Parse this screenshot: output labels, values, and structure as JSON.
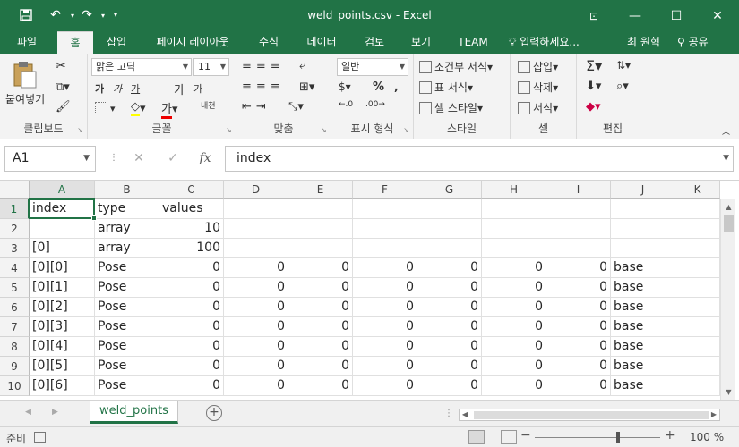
{
  "window": {
    "title": "weld_points.csv - Excel",
    "save_icon": "save-icon",
    "undo_icon": "undo-icon",
    "redo_icon": "redo-icon",
    "customize_icon": "customize-qat-icon"
  },
  "tabs": [
    "파일",
    "홈",
    "삽입",
    "페이지 레이아웃",
    "수식",
    "데이터",
    "검토",
    "보기",
    "TEAM"
  ],
  "active_tab": "홈",
  "tell_me": "입력하세요...",
  "user_name": "최 원혁",
  "share_label": "공유",
  "ribbon": {
    "clipboard": {
      "label": "클립보드",
      "paste": "붙여넣기"
    },
    "font": {
      "label": "글꼴",
      "font_name": "맑은 고딕",
      "font_size": "11",
      "bold": "가",
      "italic": "가",
      "underline": "가",
      "grow": "가",
      "shrink": "가",
      "color_text": "가",
      "phonetic": "내천"
    },
    "alignment": {
      "label": "맞춤"
    },
    "number": {
      "label": "표시 형식",
      "format": "일반"
    },
    "styles": {
      "label": "스타일",
      "conditional": "조건부 서식",
      "table": "표 서식",
      "cell": "셀 스타일"
    },
    "cells": {
      "label": "셀",
      "insert": "삽입",
      "delete": "삭제",
      "format": "서식"
    },
    "editing": {
      "label": "편집"
    }
  },
  "formula_bar": {
    "name_box": "A1",
    "cancel": "✕",
    "enter": "✓",
    "fx": "fx",
    "content": "index"
  },
  "grid": {
    "columns": [
      "A",
      "B",
      "C",
      "D",
      "E",
      "F",
      "G",
      "H",
      "I",
      "J",
      "K"
    ],
    "rows": [
      [
        "index",
        "type",
        "values",
        "",
        "",
        "",
        "",
        "",
        "",
        "",
        ""
      ],
      [
        "",
        "array",
        "10",
        "",
        "",
        "",
        "",
        "",
        "",
        "",
        ""
      ],
      [
        "[0]",
        "array",
        "100",
        "",
        "",
        "",
        "",
        "",
        "",
        "",
        ""
      ],
      [
        "[0][0]",
        "Pose",
        "0",
        "0",
        "0",
        "0",
        "0",
        "0",
        "0",
        "base",
        ""
      ],
      [
        "[0][1]",
        "Pose",
        "0",
        "0",
        "0",
        "0",
        "0",
        "0",
        "0",
        "base",
        ""
      ],
      [
        "[0][2]",
        "Pose",
        "0",
        "0",
        "0",
        "0",
        "0",
        "0",
        "0",
        "base",
        ""
      ],
      [
        "[0][3]",
        "Pose",
        "0",
        "0",
        "0",
        "0",
        "0",
        "0",
        "0",
        "base",
        ""
      ],
      [
        "[0][4]",
        "Pose",
        "0",
        "0",
        "0",
        "0",
        "0",
        "0",
        "0",
        "base",
        ""
      ],
      [
        "[0][5]",
        "Pose",
        "0",
        "0",
        "0",
        "0",
        "0",
        "0",
        "0",
        "base",
        ""
      ],
      [
        "[0][6]",
        "Pose",
        "0",
        "0",
        "0",
        "0",
        "0",
        "0",
        "0",
        "base",
        ""
      ]
    ],
    "row_numbers": [
      "1",
      "2",
      "3",
      "4",
      "5",
      "6",
      "7",
      "8",
      "9",
      "10"
    ]
  },
  "sheets": [
    "weld_points"
  ],
  "status": {
    "ready": "준비",
    "zoom": "100 %"
  },
  "colors": {
    "accent": "#217346"
  }
}
